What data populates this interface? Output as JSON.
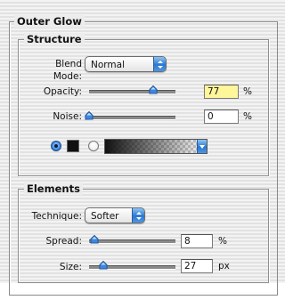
{
  "panel": {
    "title": "Outer Glow"
  },
  "structure": {
    "title": "Structure",
    "blend_mode": {
      "label": "Blend Mode:",
      "value": "Normal"
    },
    "opacity": {
      "label": "Opacity:",
      "value": "77",
      "unit": "%",
      "slider_fraction": 0.77
    },
    "noise": {
      "label": "Noise:",
      "value": "0",
      "unit": "%",
      "slider_fraction": 0.0
    },
    "color_mode_selected": "solid",
    "glow_color": "#111111"
  },
  "elements": {
    "title": "Elements",
    "technique": {
      "label": "Technique:",
      "value": "Softer"
    },
    "spread": {
      "label": "Spread:",
      "value": "8",
      "unit": "%",
      "slider_fraction": 0.08
    },
    "size": {
      "label": "Size:",
      "value": "27",
      "unit": "px",
      "slider_fraction": 0.18
    }
  },
  "colors": {
    "accent": "#2b78d0",
    "highlight_field": "#fff59a"
  }
}
